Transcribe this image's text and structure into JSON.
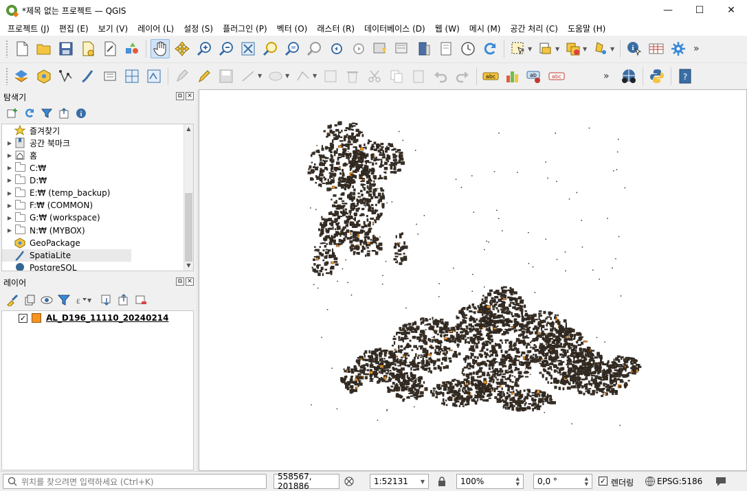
{
  "window": {
    "title": "*제목 없는 프로젝트 — QGIS",
    "minimize": "—",
    "maximize": "☐",
    "close": "✕"
  },
  "menu": [
    "프로젝트 (J)",
    "편집 (E)",
    "보기 (V)",
    "레이어 (L)",
    "설정 (S)",
    "플러그인 (P)",
    "벡터 (O)",
    "래스터 (R)",
    "데이터베이스 (D)",
    "웹 (W)",
    "메시 (M)",
    "공간 처리 (C)",
    "도움말 (H)"
  ],
  "browser_panel": {
    "title": "탐색기",
    "items": [
      {
        "label": "즐겨찾기",
        "icon": "star-icon",
        "expandable": false
      },
      {
        "label": "공간 북마크",
        "icon": "bookmark-icon",
        "expandable": true
      },
      {
        "label": "홈",
        "icon": "home-icon",
        "expandable": true
      },
      {
        "label": "C:₩",
        "icon": "folder-icon",
        "expandable": true
      },
      {
        "label": "D:₩",
        "icon": "folder-icon",
        "expandable": true
      },
      {
        "label": "E:₩ (temp_backup)",
        "icon": "folder-icon",
        "expandable": true
      },
      {
        "label": "F:₩ (COMMON)",
        "icon": "folder-icon",
        "expandable": true
      },
      {
        "label": "G:₩ (workspace)",
        "icon": "folder-icon",
        "expandable": true
      },
      {
        "label": "N:₩ (MYBOX)",
        "icon": "folder-icon",
        "expandable": true
      },
      {
        "label": "GeoPackage",
        "icon": "geopackage-icon",
        "expandable": false
      },
      {
        "label": "SpatiaLite",
        "icon": "spatialite-icon",
        "expandable": false
      },
      {
        "label": "PostgreSQL",
        "icon": "postgresql-icon",
        "expandable": false
      }
    ]
  },
  "layers_panel": {
    "title": "레이어",
    "layers": [
      {
        "name": "AL_D196_11110_20240214",
        "checked": true,
        "color": "#f7931e"
      }
    ]
  },
  "statusbar": {
    "search_placeholder": "위치를 찾으려면 입력하세요 (Ctrl+K)",
    "coordinate": "558567, 201886",
    "scale": "1:52131",
    "magnifier": "100%",
    "rotation": "0,0 °",
    "render_label": "렌더링",
    "render_checked": true,
    "crs": "EPSG:5186"
  },
  "colors": {
    "feature_dark": "#3a3026",
    "feature_highlight": "#f7931e",
    "map_background": "#ffffff"
  }
}
